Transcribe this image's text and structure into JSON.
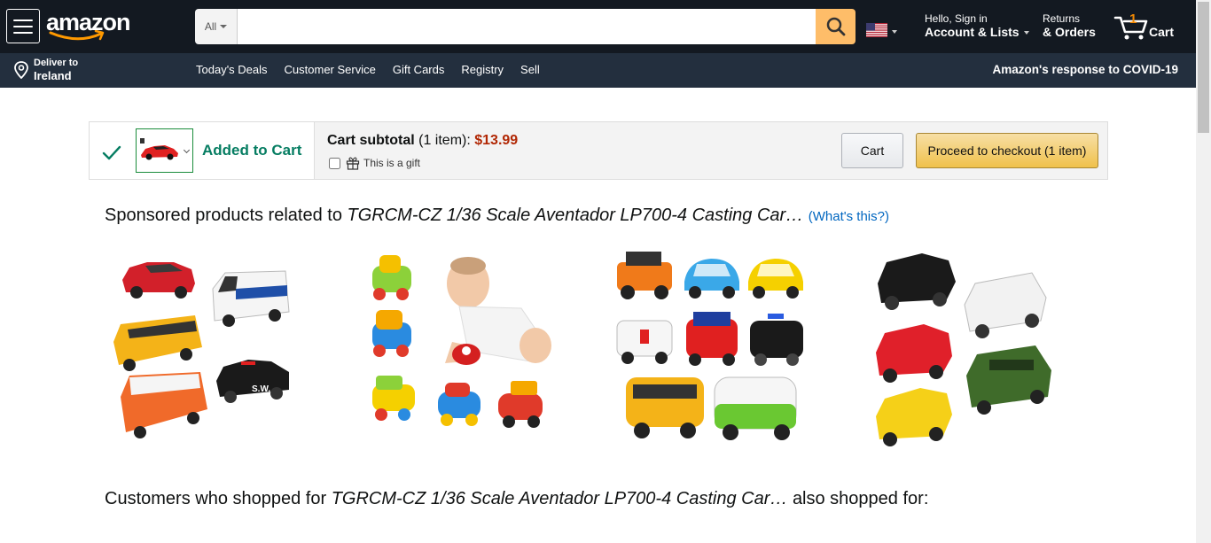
{
  "nav": {
    "logo_text": "amazon",
    "search_category": "All",
    "search_placeholder": "",
    "account_line1": "Hello, Sign in",
    "account_line2": "Account & Lists",
    "returns_line1": "Returns",
    "returns_line2": "& Orders",
    "cart_count": "1",
    "cart_label": "Cart"
  },
  "subnav": {
    "deliver_line1": "Deliver to",
    "deliver_line2": "Ireland",
    "links": [
      "Today's Deals",
      "Customer Service",
      "Gift Cards",
      "Registry",
      "Sell"
    ],
    "covid": "Amazon's response to COVID-19"
  },
  "cart_box": {
    "added_label": "Added to Cart",
    "subtotal_label": "Cart subtotal",
    "item_count": "(1 item):",
    "price": "$13.99",
    "gift_label": "This is a gift",
    "cart_button": "Cart",
    "checkout_button": "Proceed to checkout (1 item)"
  },
  "sponsored": {
    "prefix": "Sponsored products related to",
    "product_title": "TGRCM-CZ 1/36 Scale Aventador LP700-4 Casting Car…",
    "whats_this": "(What's this?)"
  },
  "shopped": {
    "prefix": "Customers who shopped for",
    "product_title": "TGRCM-CZ 1/36 Scale Aventador LP700-4 Casting Car…",
    "suffix": "also shopped for:"
  },
  "colors": {
    "nav_bg": "#131921",
    "subnav_bg": "#232f3e",
    "search_button": "#febd69",
    "price": "#B12704",
    "success": "#067d62",
    "link": "#0066c0"
  }
}
